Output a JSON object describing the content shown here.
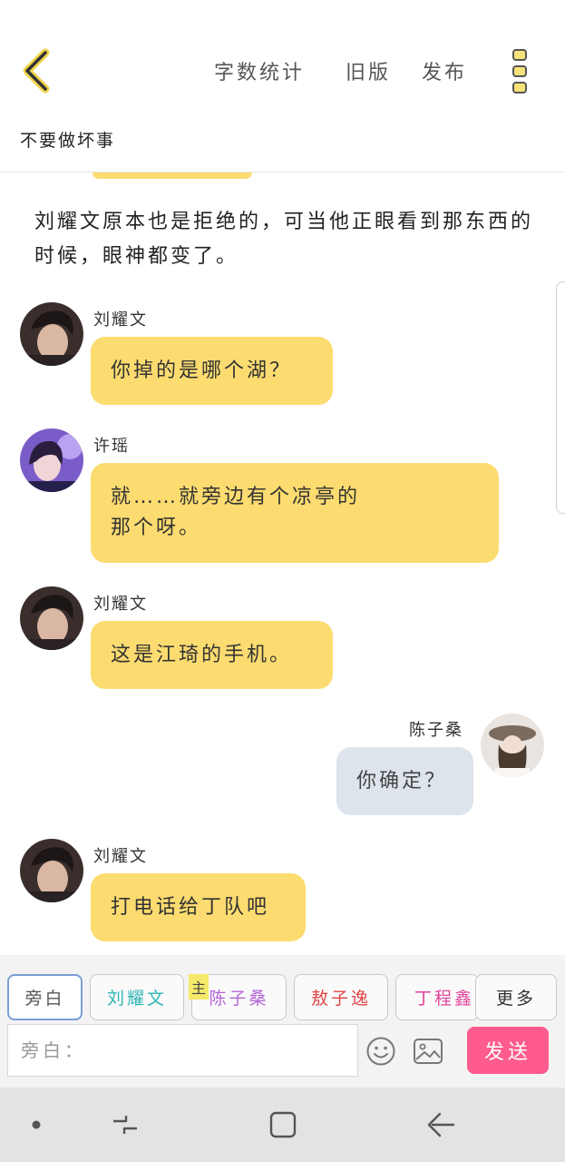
{
  "header": {
    "actions": [
      "字数统计",
      "旧版",
      "发布"
    ]
  },
  "story_title": "不要做坏事",
  "narration": "刘耀文原本也是拒绝的，可当他正眼看到那东西的时候，眼神都变了。",
  "messages": [
    {
      "speaker": "刘耀文",
      "text": "你掉的是哪个湖？"
    },
    {
      "speaker": "许瑶",
      "lines": [
        "就……就旁边有个凉亭的",
        "那个呀。"
      ]
    },
    {
      "speaker": "刘耀文",
      "text": "这是江琦的手机。"
    },
    {
      "speaker": "陈子桑",
      "text": "你确定？"
    },
    {
      "speaker": "刘耀文",
      "text": "打电话给丁队吧"
    }
  ],
  "characters": [
    {
      "label": "旁白",
      "color": "#555555"
    },
    {
      "label": "刘耀文",
      "color": "#2fb5b5"
    },
    {
      "label": "陈子桑",
      "color": "#b565d8"
    },
    {
      "label": "敖子逸",
      "color": "#e04545"
    },
    {
      "label": "丁程鑫",
      "color": "#e0459a"
    },
    {
      "label": "更多",
      "color": "#333333"
    }
  ],
  "main_tag": "主",
  "input": {
    "placeholder": "旁白："
  },
  "send_label": "发送",
  "colors": {
    "accent_yellow": "#fcdc70",
    "send_pink": "#ff5b8e",
    "bubble_gray": "#dde4ec"
  }
}
